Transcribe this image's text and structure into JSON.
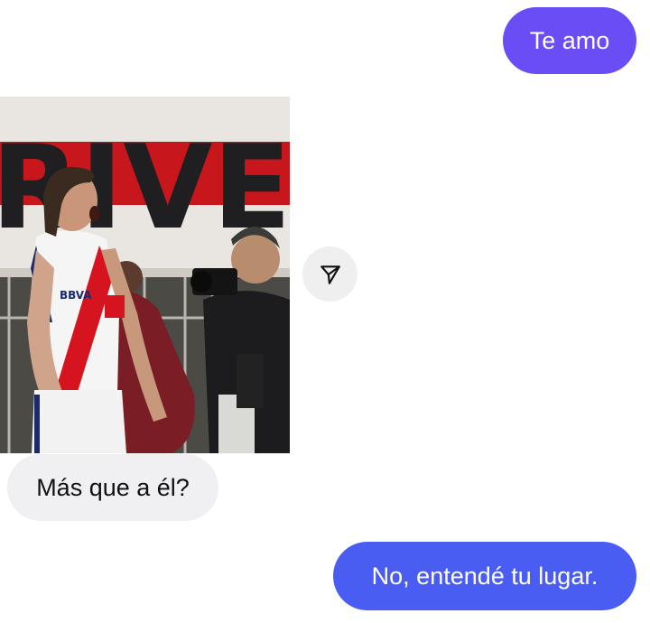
{
  "messages": [
    {
      "direction": "outgoing",
      "text": "Te amo"
    },
    {
      "direction": "incoming",
      "text": "Más que a él?"
    },
    {
      "direction": "outgoing",
      "text": "No, entendé tu lugar."
    }
  ],
  "photo": {
    "banner_text": "RIVER",
    "jersey_text": "BBVA"
  },
  "icons": {
    "share": "paper-plane-icon"
  },
  "colors": {
    "outgoing_bubble_1": "#6a4df4",
    "outgoing_bubble_2": "#4a5df2",
    "incoming_bubble": "#f0f0f2",
    "banner_stripe": "#c8161d"
  }
}
